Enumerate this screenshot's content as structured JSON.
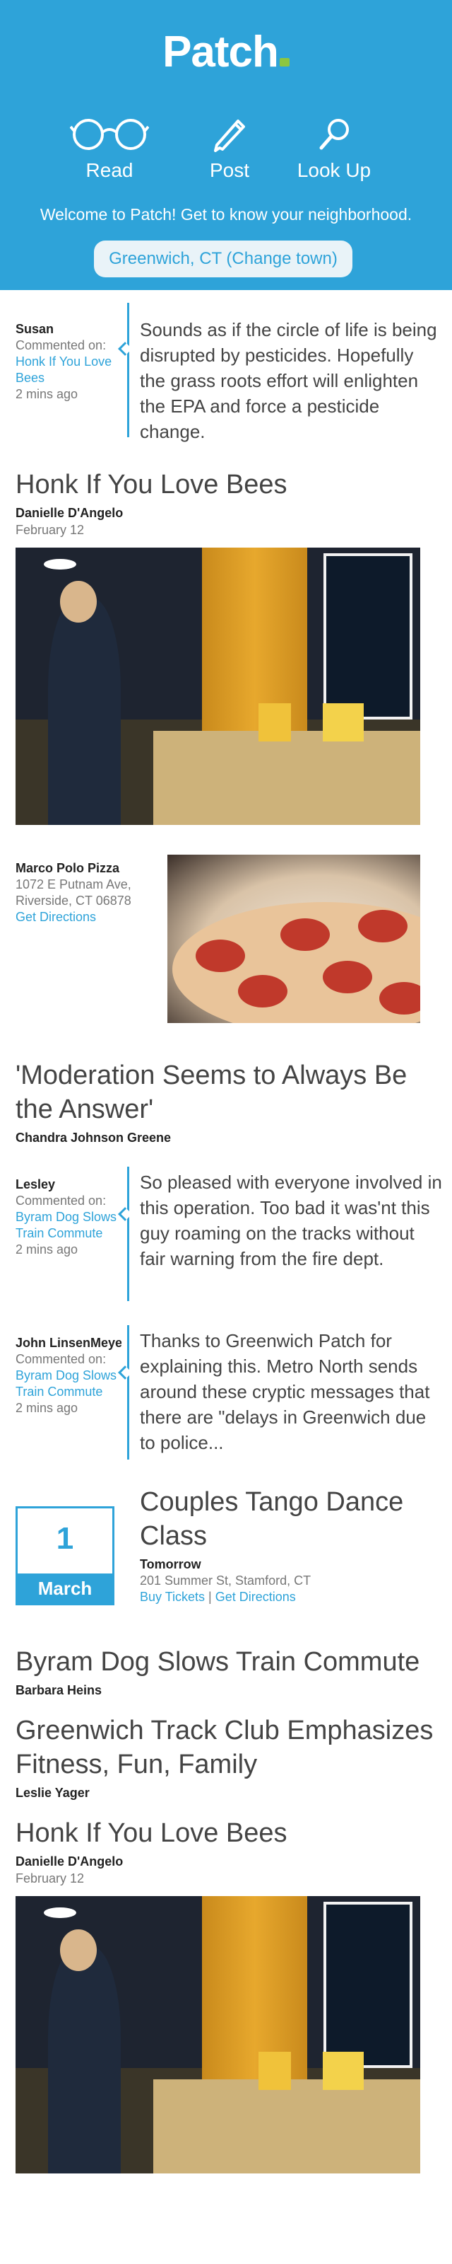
{
  "header": {
    "logo": "Patch",
    "nav": [
      {
        "label": "Read",
        "icon": "glasses-icon"
      },
      {
        "label": "Post",
        "icon": "pencil-icon"
      },
      {
        "label": "Look Up",
        "icon": "magnifier-icon"
      }
    ],
    "welcome": "Welcome to Patch! Get to know your neighborhood.",
    "town_button": "Greenwich, CT (Change town)"
  },
  "colors": {
    "brand_blue": "#2ea3d9",
    "logo_check": "#8cc63f"
  },
  "comments": [
    {
      "author": "Susan",
      "label": "Commented on:",
      "link": "Honk If You Love Bees",
      "time": "2 mins ago",
      "text": "Sounds as if the circle of life is being disrupted by pesticides. Hopefully the grass roots effort will enlighten the EPA and force a pesticide change."
    },
    {
      "author": "Lesley",
      "label": "Commented on:",
      "link": "Byram Dog Slows Train Commute",
      "time": "2 mins ago",
      "text": "So pleased with everyone involved in this operation. Too bad it was'nt this guy roaming on the tracks without fair warning from the fire dept."
    },
    {
      "author": "John LinsenMeyer",
      "label": "Commented on:",
      "link": "Byram Dog Slows Train Commute",
      "time": "2 mins ago",
      "text": "Thanks to Greenwich Patch for explaining this. Metro North sends around these cryptic messages that there are \"delays in Greenwich due to police..."
    }
  ],
  "articles": [
    {
      "title": "Honk If You Love Bees",
      "author": "Danielle D'Angelo",
      "date": "February 12"
    },
    {
      "title": "'Moderation Seems to Always Be the Answer'",
      "author": "Chandra Johnson Greene"
    },
    {
      "title": "Byram Dog Slows Train Commute",
      "author": "Barbara Heins"
    },
    {
      "title": "Greenwich Track Club Emphasizes Fitness, Fun, Family",
      "author": "Leslie Yager"
    },
    {
      "title": "Honk If You Love Bees",
      "author": "Danielle D'Angelo",
      "date": "February 12"
    }
  ],
  "listing": {
    "name": "Marco Polo Pizza",
    "address": "1072 E Putnam Ave, Riverside, CT 06878",
    "directions": "Get Directions"
  },
  "event": {
    "day": "1",
    "month": "March",
    "title": "Couples Tango Dance Class",
    "when": "Tomorrow",
    "where": "201 Summer St, Stamford, CT",
    "tickets": "Buy Tickets",
    "separator": "|",
    "directions": "Get Directions"
  }
}
